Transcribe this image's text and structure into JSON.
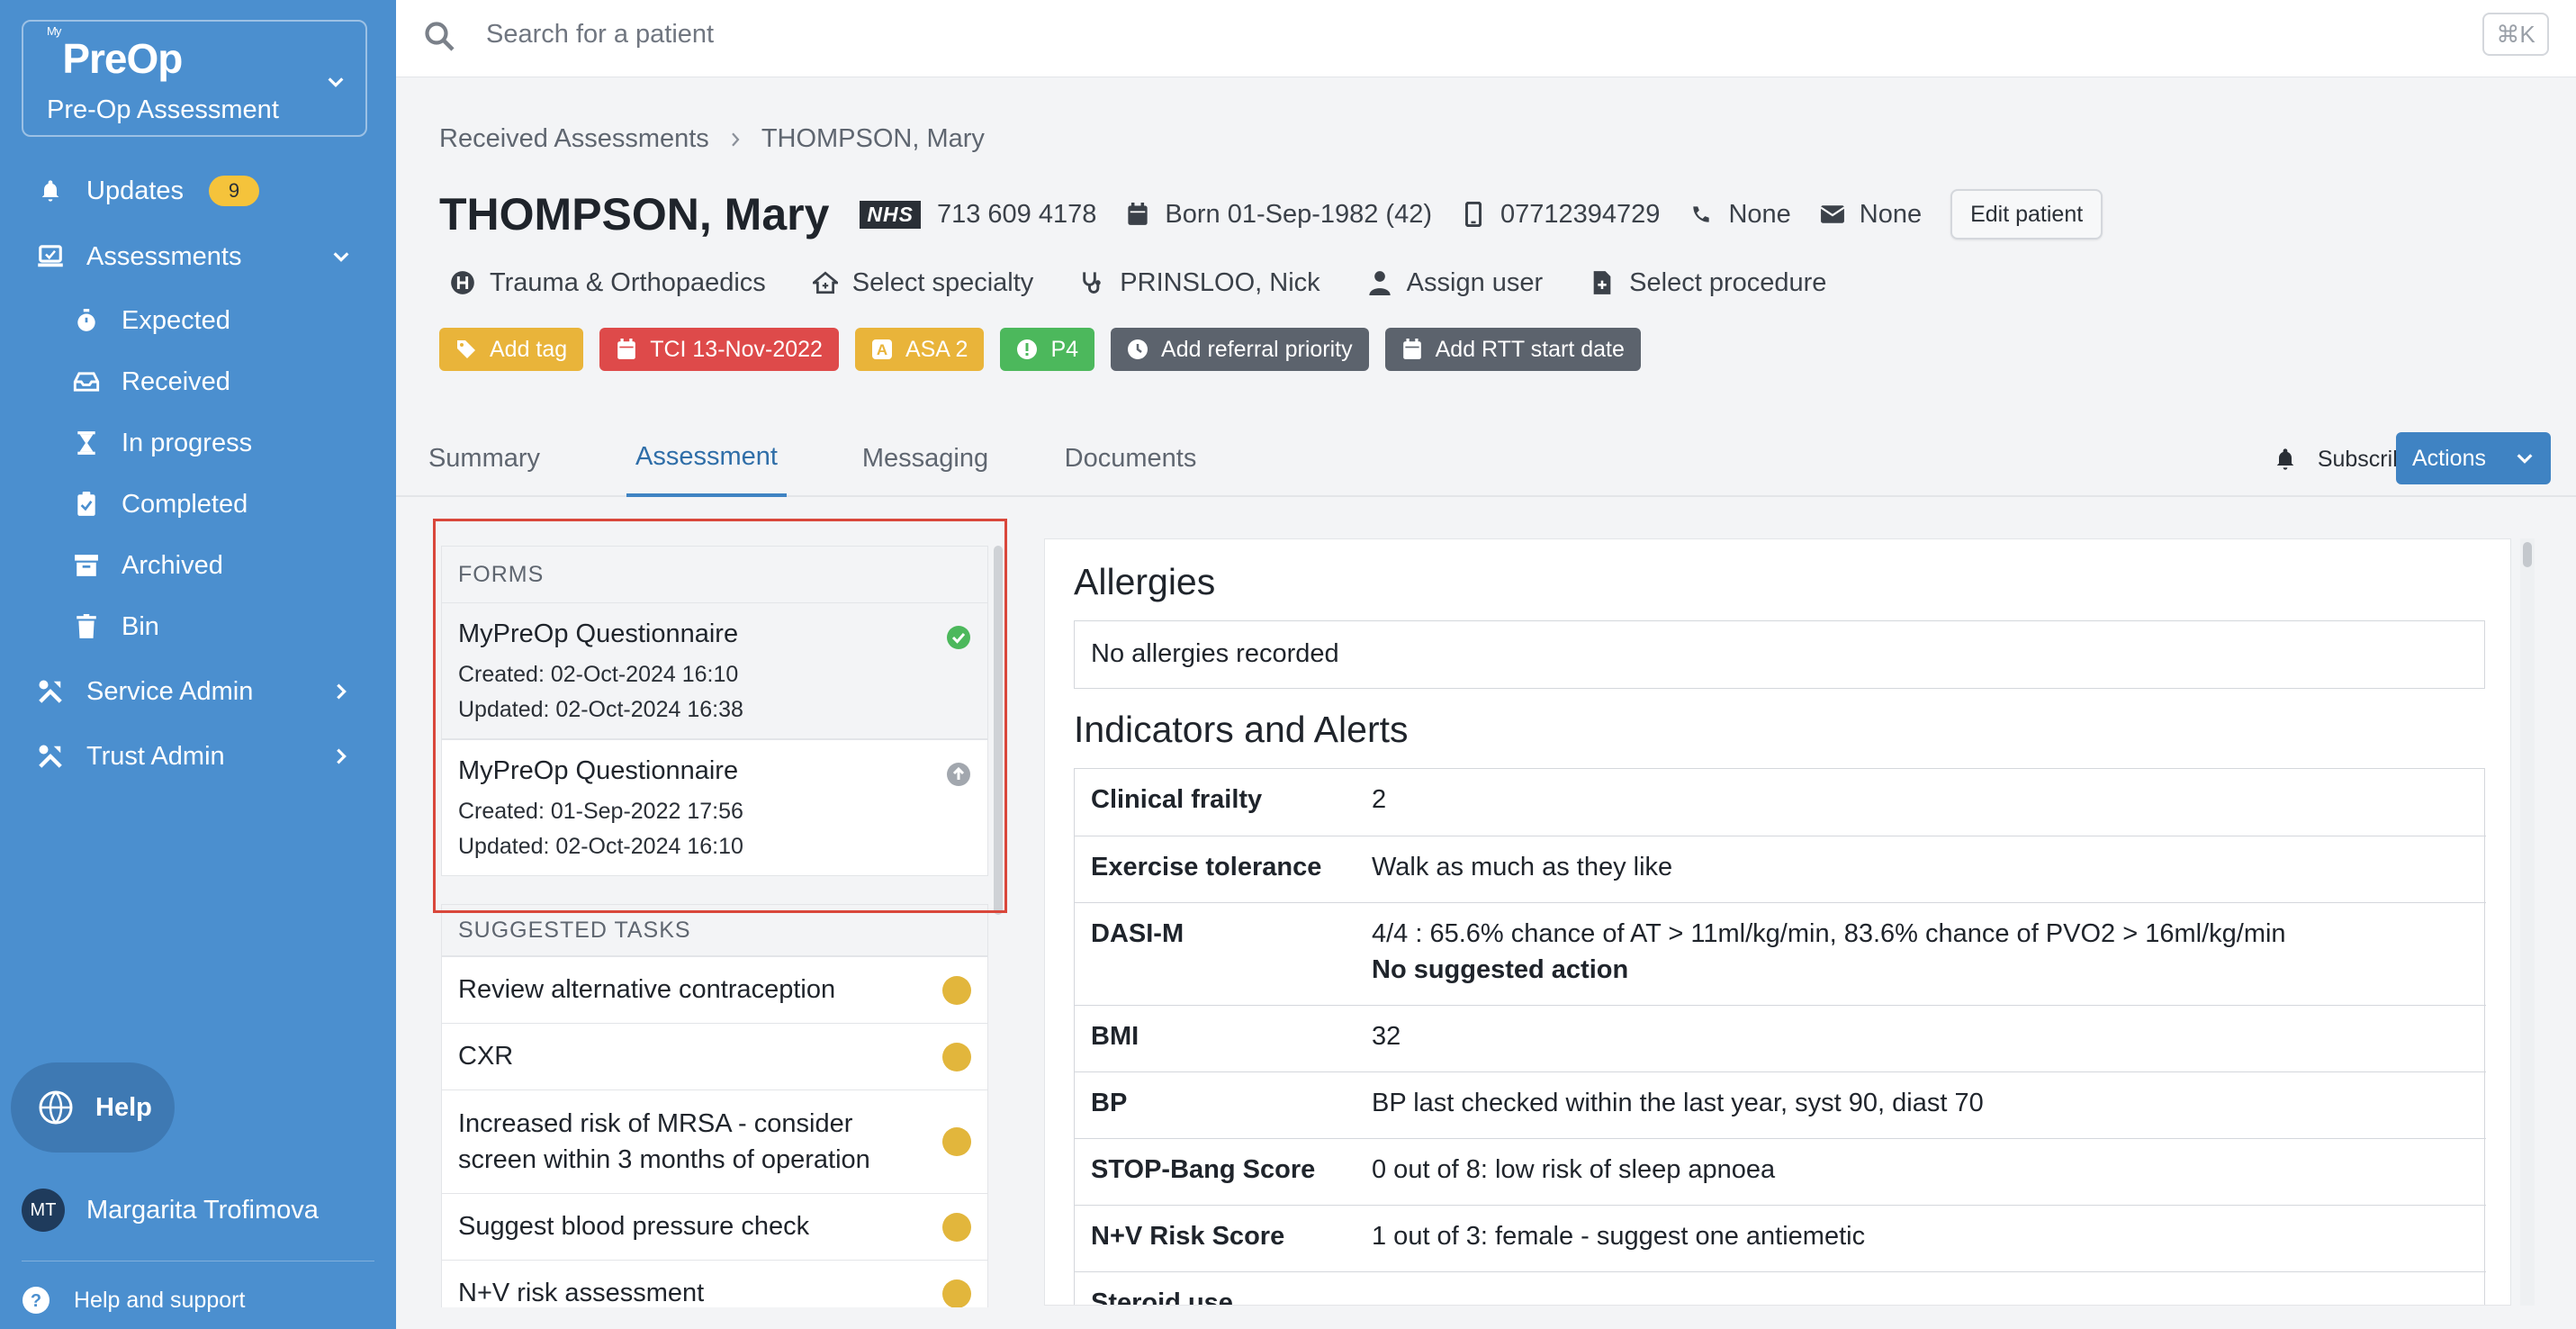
{
  "app": {
    "logo_prefix": "My",
    "logo": "PreOp",
    "module": "Pre-Op Assessment"
  },
  "sidebar": {
    "updates": {
      "label": "Updates",
      "count": "9"
    },
    "assessments": {
      "label": "Assessments"
    },
    "sub_items": [
      {
        "label": "Expected",
        "icon": "stopwatch-icon"
      },
      {
        "label": "Received",
        "icon": "inbox-icon"
      },
      {
        "label": "In progress",
        "icon": "hourglass-icon"
      },
      {
        "label": "Completed",
        "icon": "clipboard-check-icon"
      },
      {
        "label": "Archived",
        "icon": "archive-icon"
      },
      {
        "label": "Bin",
        "icon": "trash-icon"
      }
    ],
    "service_admin": "Service Admin",
    "trust_admin": "Trust Admin",
    "help": "Help",
    "user": {
      "initials": "MT",
      "name": "Margarita Trofimova"
    },
    "support": "Help and support"
  },
  "search": {
    "placeholder": "Search for a patient",
    "shortcut": "⌘K"
  },
  "breadcrumb": {
    "parent": "Received Assessments",
    "current": "THOMPSON, Mary"
  },
  "patient": {
    "name": "THOMPSON, Mary",
    "nhs_logo": "NHS",
    "nhs_number": "713 609 4178",
    "born": "Born 01-Sep-1982 (42)",
    "mobile": "07712394729",
    "phone": "None",
    "email": "None",
    "edit_label": "Edit patient",
    "department": "Trauma & Orthopaedics",
    "specialty": "Select specialty",
    "clinician": "PRINSLOO, Nick",
    "assign": "Assign user",
    "procedure": "Select procedure"
  },
  "tags": {
    "add_tag": "Add tag",
    "tci": "TCI 13-Nov-2022",
    "asa": "ASA 2",
    "priority": "P4",
    "referral": "Add referral priority",
    "rtt": "Add RTT start date"
  },
  "tabs": [
    "Summary",
    "Assessment",
    "Messaging",
    "Documents"
  ],
  "tab_active": "Assessment",
  "subscribe": "Subscribe",
  "actions": "Actions",
  "forms": {
    "heading": "FORMS",
    "items": [
      {
        "title": "MyPreOp Questionnaire",
        "created": "Created: 02-Oct-2024 16:10",
        "updated": "Updated: 02-Oct-2024 16:38",
        "status": "complete"
      },
      {
        "title": "MyPreOp Questionnaire",
        "created": "Created: 01-Sep-2022 17:56",
        "updated": "Updated: 02-Oct-2024 16:10",
        "status": "superseded"
      }
    ]
  },
  "tasks": {
    "heading": "SUGGESTED TASKS",
    "items": [
      "Review alternative contraception",
      "CXR",
      "Increased risk of MRSA - consider screen within 3 months of operation",
      "Suggest blood pressure check",
      "N+V risk assessment"
    ]
  },
  "allergies": {
    "heading": "Allergies",
    "text": "No allergies recorded"
  },
  "indicators": {
    "heading": "Indicators and Alerts",
    "rows": [
      {
        "key": "Clinical frailty",
        "value": "2"
      },
      {
        "key": "Exercise tolerance",
        "value": "Walk as much as they like"
      },
      {
        "key": "DASI-M",
        "value": "4/4 : 65.6% chance of AT > 11ml/kg/min, 83.6% chance of PVO2 > 16ml/kg/min",
        "note": "No suggested action"
      },
      {
        "key": "BMI",
        "value": "32"
      },
      {
        "key": "BP",
        "value": "BP last checked within the last year, syst 90, diast 70"
      },
      {
        "key": "STOP-Bang Score",
        "value": "0 out of 8: low risk of sleep apnoea"
      },
      {
        "key": "N+V Risk Score",
        "value": "1 out of 3: female - suggest one antiemetic"
      },
      {
        "key": "Steroid use",
        "value": ""
      }
    ]
  },
  "colors": {
    "sidebar": "#4b8fcf",
    "accent": "#3f83c3",
    "tag_yellow": "#e9b43a",
    "tag_red": "#de4a4a",
    "tag_green": "#4cb85c",
    "tag_gray": "#5c636d"
  }
}
